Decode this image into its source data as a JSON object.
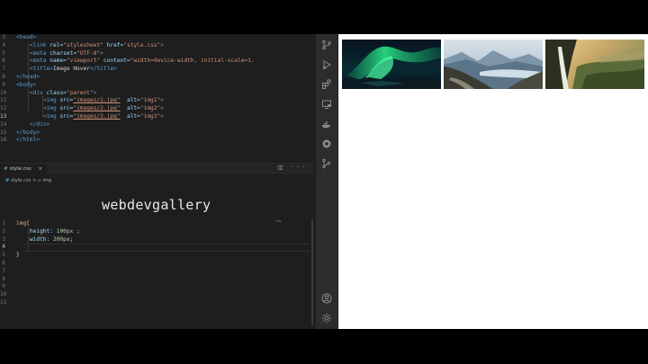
{
  "html_editor": {
    "lines": [
      {
        "n": "3"
      },
      {
        "n": "4"
      },
      {
        "n": "5"
      },
      {
        "n": "6"
      },
      {
        "n": "7"
      },
      {
        "n": "8"
      },
      {
        "n": "9"
      },
      {
        "n": "10"
      },
      {
        "n": "11"
      },
      {
        "n": "12"
      },
      {
        "n": "13"
      },
      {
        "n": "14"
      },
      {
        "n": "15"
      },
      {
        "n": "16"
      }
    ],
    "tokens": {
      "head_open": "<head>",
      "link_tag": "<link",
      "rel_attr": "rel=",
      "rel_val": "\"stylesheet\"",
      "href_attr": "href=",
      "href_val": "\"style.css\"",
      "link_close": ">",
      "meta1_tag": "<meta",
      "charset_attr": "charset=",
      "charset_val": "\"UTF-8\"",
      "meta2_tag": "<meta",
      "name_attr": "name=",
      "name_val": "\"viewport\"",
      "content_attr": "content=",
      "content_val": "\"width=device-width, initial-scale=1.",
      "title_open": "<title>",
      "title_text": "Image Hover",
      "title_close": "</title>",
      "head_close": "</head>",
      "body_open": "<body>",
      "div_tag": "<div",
      "class_attr": "class=",
      "class_val": "\"parent\"",
      "img_tag": "<img",
      "src_attr": "src=",
      "src1": "\"images/1.jpg\"",
      "src2": "\"images/2.jpg\"",
      "src3": "\"images/3.jpg\"",
      "alt_attr": "alt=",
      "alt1": "\"img1\"",
      "alt2": "\"img2\"",
      "alt3": "\"img3\"",
      "div_close": "</div>",
      "body_close": "</body>",
      "html_close": "</html>"
    }
  },
  "css_editor": {
    "tab_label": "style.css",
    "tab_close": "×",
    "tab_actions": "◫ ···",
    "breadcrumb": {
      "hash": "#",
      "file": "style.css",
      "sep": ">",
      "selector": "img"
    },
    "line_numbers": [
      "1",
      "2",
      "3",
      "4",
      "5",
      "6",
      "7",
      "8",
      "9",
      "10",
      "11"
    ],
    "code": {
      "selector": "img{",
      "height_prop": "height: ",
      "height_val": "100px",
      "height_end": " ;",
      "width_prop": "width: ",
      "width_val": "200px",
      "width_end": ";",
      "close_brace": "}"
    },
    "minimap_label": "img"
  },
  "watermark": "webdevgallery",
  "activity_bar": {
    "icons": [
      "source-control-icon",
      "run-debug-icon",
      "extensions-icon",
      "remote-explorer-icon",
      "docker-icon",
      "browser-icon",
      "git-graph-icon",
      "account-icon",
      "settings-gear-icon"
    ]
  },
  "preview": {
    "images": [
      {
        "alt": "img1",
        "scene": "aurora-icon"
      },
      {
        "alt": "img2",
        "scene": "mountain-lake-icon"
      },
      {
        "alt": "img3",
        "scene": "waterfall-cliff-icon"
      }
    ]
  }
}
